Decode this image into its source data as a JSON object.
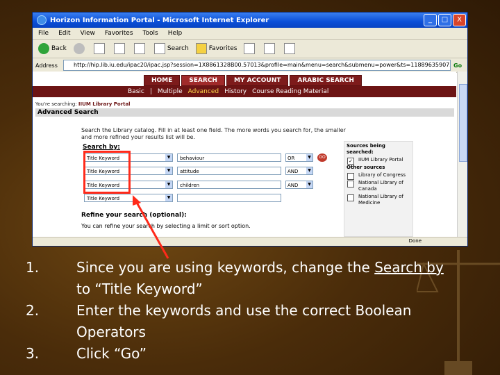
{
  "window": {
    "title": "Horizon Information Portal - Microsoft Internet Explorer",
    "controls": [
      "_",
      "□",
      "X"
    ]
  },
  "menu": [
    "File",
    "Edit",
    "View",
    "Favorites",
    "Tools",
    "Help"
  ],
  "toolbar": {
    "back": "Back",
    "search": "Search",
    "favorites": "Favorites"
  },
  "address": {
    "label": "Address",
    "url": "http://hip.lib.iu.edu/ipac20/ipac.jsp?session=1X8861328B00.57013&profile=main&menu=search&submenu=power&ts=1188963590732",
    "go": "Go"
  },
  "portal": {
    "tabs": [
      "HOME",
      "SEARCH",
      "MY ACCOUNT",
      "ARABIC SEARCH"
    ],
    "active_tab": "SEARCH",
    "subnav": [
      "Basic",
      "Multiple",
      "Advanced",
      "History",
      "Course Reading Material"
    ],
    "subnav_selected": "Advanced",
    "searching_prefix": "You're searching:",
    "searching_name": "IIUM Library Portal",
    "page_title": "Advanced Search",
    "instructions": "Search the Library catalog. Fill in at least one field. The more words you search for, the smaller and more refined your results list will be.",
    "search_by_label": "Search by:",
    "rows": [
      {
        "field": "Title Keyword",
        "value": "behaviour",
        "operator": "OR"
      },
      {
        "field": "Title Keyword",
        "value": "attitude",
        "operator": "AND"
      },
      {
        "field": "Title Keyword",
        "value": "children",
        "operator": "AND"
      },
      {
        "field": "Title Keyword",
        "value": "",
        "operator": ""
      }
    ],
    "go_label": "GO",
    "refine_label": "Refine your search (optional):",
    "refine_text": "You can refine your search by selecting a limit or sort option.",
    "sources": {
      "heading": "Sources being searched:",
      "primary": "IIUM Library Portal",
      "other_heading": "Other sources",
      "others": [
        "Library of Congress",
        "National Library of Canada",
        "National Library of Medicine"
      ]
    },
    "status": "Done"
  },
  "steps": [
    {
      "num": "1.",
      "before": "Since you are using keywords, change the ",
      "link": "Search by",
      "cont": "to “Title Keyword”"
    },
    {
      "num": "2.",
      "before": "Enter the keywords and use the correct Boolean",
      "link": "",
      "cont": "Operators"
    },
    {
      "num": "3.",
      "before": "Click “Go”",
      "link": "",
      "cont": ""
    }
  ],
  "colors": {
    "background": "#4a2c0a",
    "portal_nav": "#6c1414",
    "highlight": "#ff2a1a"
  }
}
